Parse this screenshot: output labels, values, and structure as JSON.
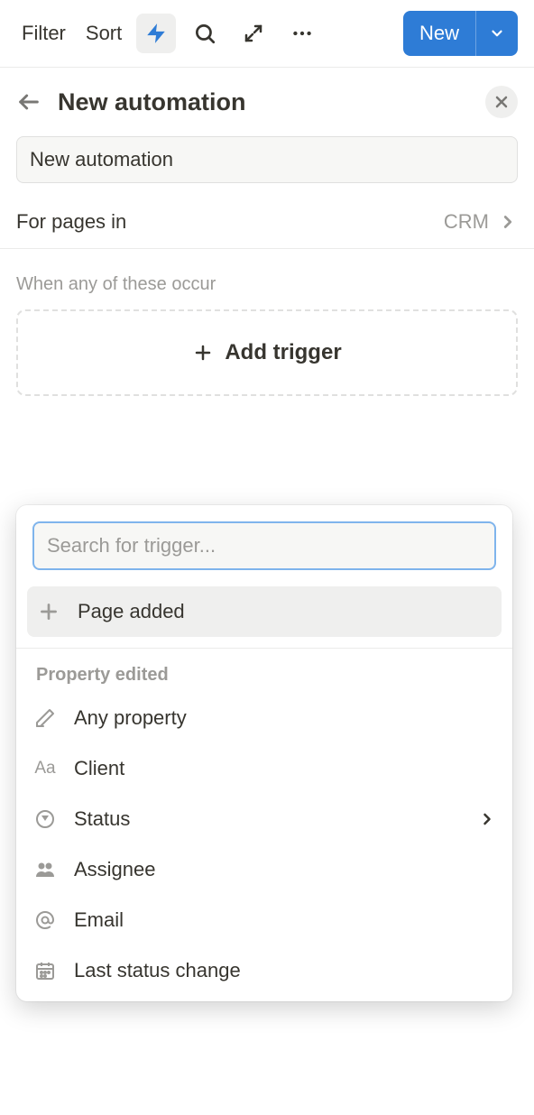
{
  "toolbar": {
    "filter_label": "Filter",
    "sort_label": "Sort",
    "new_label": "New"
  },
  "panel": {
    "title": "New automation",
    "name_value": "New automation",
    "scope_label": "For pages in",
    "scope_value": "CRM"
  },
  "triggers": {
    "section_label": "When any of these occur",
    "add_label": "Add trigger"
  },
  "dropdown": {
    "search_placeholder": "Search for trigger...",
    "page_added_label": "Page added",
    "property_section_label": "Property edited",
    "items": [
      {
        "label": "Any property",
        "icon": "pencil"
      },
      {
        "label": "Client",
        "icon": "text"
      },
      {
        "label": "Status",
        "icon": "status",
        "has_submenu": true
      },
      {
        "label": "Assignee",
        "icon": "person"
      },
      {
        "label": "Email",
        "icon": "at"
      },
      {
        "label": "Last status change",
        "icon": "date"
      }
    ]
  }
}
